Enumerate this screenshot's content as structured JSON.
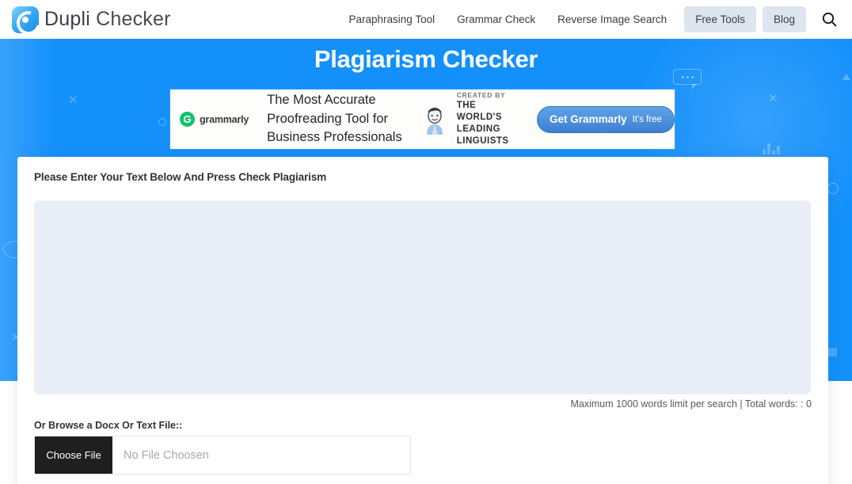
{
  "navbar": {
    "brand": {
      "word1": "Dupli",
      "word2": "Checker",
      "icon": "duplichecker-logo-icon"
    },
    "links": [
      {
        "label": "Paraphrasing Tool",
        "pill": false
      },
      {
        "label": "Grammar Check",
        "pill": false
      },
      {
        "label": "Reverse Image Search",
        "pill": false
      },
      {
        "label": "Free Tools",
        "pill": true
      },
      {
        "label": "Blog",
        "pill": true
      }
    ],
    "search_icon": "search-icon"
  },
  "hero": {
    "title": "Plagiarism Checker",
    "background_color": "#1490fb"
  },
  "ad": {
    "logo_letter": "G",
    "logo_name": "grammarly",
    "headline_line1": "The Most Accurate",
    "headline_line2": "Proofreading Tool for",
    "headline_line3": "Business Professionals",
    "credit_line1": "CREATED BY",
    "credit_line2": "THE WORLD'S",
    "credit_line3": "LEADING LINGUISTS",
    "cta_main": "Get Grammarly",
    "cta_sub": "It's free",
    "cta_color": "#3d7fd1",
    "brand_color": "#15c26b"
  },
  "main": {
    "prompt_label": "Please Enter Your Text Below And Press Check Plagiarism",
    "editor_value": "",
    "editor_placeholder": "",
    "word_meta": "Maximum 1000 words limit per search | Total words: : 0",
    "browse_label": "Or Browse a Docx Or Text File::",
    "choose_file_label": "Choose File",
    "file_name_value": "No File Choosen"
  }
}
